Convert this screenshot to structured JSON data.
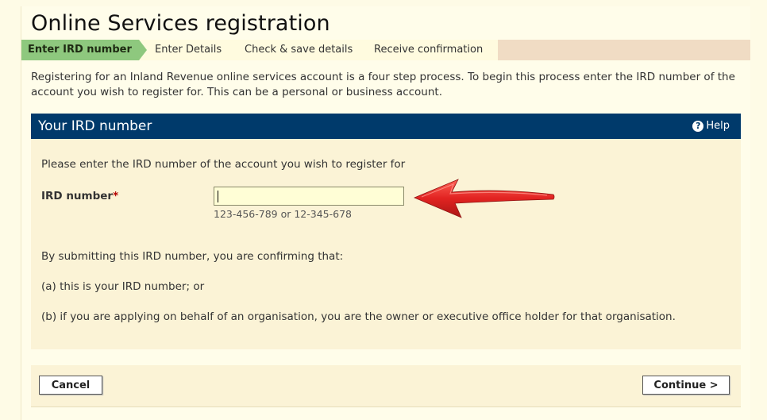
{
  "page_title": "Online Services registration",
  "steps": [
    {
      "label": "Enter IRD number",
      "active": true
    },
    {
      "label": "Enter Details",
      "active": false
    },
    {
      "label": "Check & save details",
      "active": false
    },
    {
      "label": "Receive confirmation",
      "active": false
    }
  ],
  "intro": "Registering for an Inland Revenue online services account is a four step process. To begin this process enter the IRD number of the account you wish to register for. This can be a personal or business account.",
  "panel": {
    "title": "Your IRD number",
    "help_label": "Help",
    "prompt": "Please enter the IRD number of the account you wish to register for",
    "field_label": "IRD number",
    "required_mark": "*",
    "input_value": "",
    "hint": "123-456-789 or 12-345-678",
    "confirm_intro": "By submitting this IRD number, you are confirming that:",
    "confirm_a": "(a) this is your IRD number; or",
    "confirm_b": "(b) if you are applying on behalf of an organisation, you are the owner or executive office holder for that organisation."
  },
  "footer": {
    "cancel_label": "Cancel",
    "continue_label": "Continue >"
  },
  "colors": {
    "header_bar": "#003a6b",
    "active_step": "#8ec87e",
    "arrow": "#e01818"
  },
  "icons": [
    "help-icon",
    "red-pointer-arrow"
  ]
}
